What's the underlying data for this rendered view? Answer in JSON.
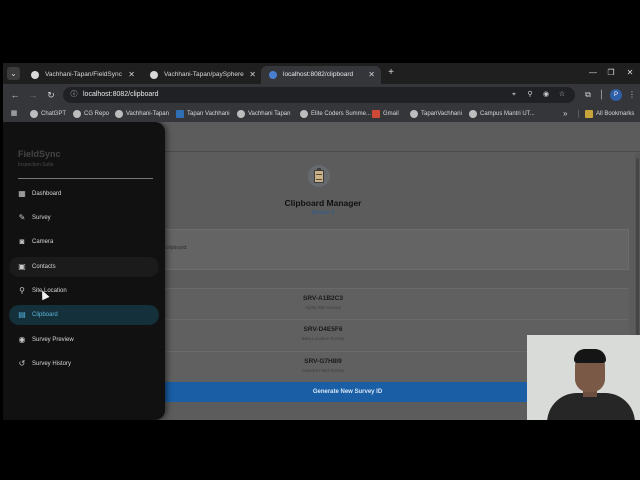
{
  "browser": {
    "tabs": [
      {
        "title": "Vachhani-Tapan/FieldSync",
        "active": false
      },
      {
        "title": "Vachhani-Tapan/paySphere",
        "active": false
      },
      {
        "title": "localhost:8082/clipboard",
        "active": true
      }
    ],
    "url": "localhost:8082/clipboard",
    "profile_initial": "P",
    "bookmarks": [
      "ChatGPT",
      "CG Repo",
      "Vachhani-Tapan",
      "Tapan Vachhani",
      "Vachhani Tapan",
      "Elite Coders Summe...",
      "Gmail",
      "TapanVachhani",
      "Campus Mantri UT..."
    ],
    "all_bookmarks": "All Bookmarks"
  },
  "drawer": {
    "brand": "FieldSync",
    "brand_sub": "Inspection Suite",
    "items": [
      {
        "label": "Dashboard",
        "icon": "dashboard-icon"
      },
      {
        "label": "Survey",
        "icon": "pencil-icon"
      },
      {
        "label": "Camera",
        "icon": "camera-icon"
      },
      {
        "label": "Contacts",
        "icon": "contacts-icon"
      },
      {
        "label": "Site Location",
        "icon": "location-pin-icon"
      },
      {
        "label": "Clipboard",
        "icon": "clipboard-icon"
      },
      {
        "label": "Survey Preview",
        "icon": "eye-icon"
      },
      {
        "label": "Survey History",
        "icon": "history-icon"
      }
    ],
    "active_item": "Clipboard",
    "hover_item": "Contacts"
  },
  "main": {
    "title": "Clipboard Manager",
    "subtitle": "Module 6",
    "info_text": "clipboard.",
    "surveys": [
      {
        "id": "SRV-A1B2C3",
        "name": "Alpha Site Survey"
      },
      {
        "id": "SRV-D4E5F6",
        "name": "Beta Location Survey"
      },
      {
        "id": "SRV-G7H8I9",
        "name": "Gamma Field Survey"
      }
    ],
    "generate_label": "Generate New Survey ID"
  },
  "colors": {
    "accent": "#1a5ea6",
    "active_nav": "#5db8dc",
    "drawer_bg": "#111111"
  }
}
